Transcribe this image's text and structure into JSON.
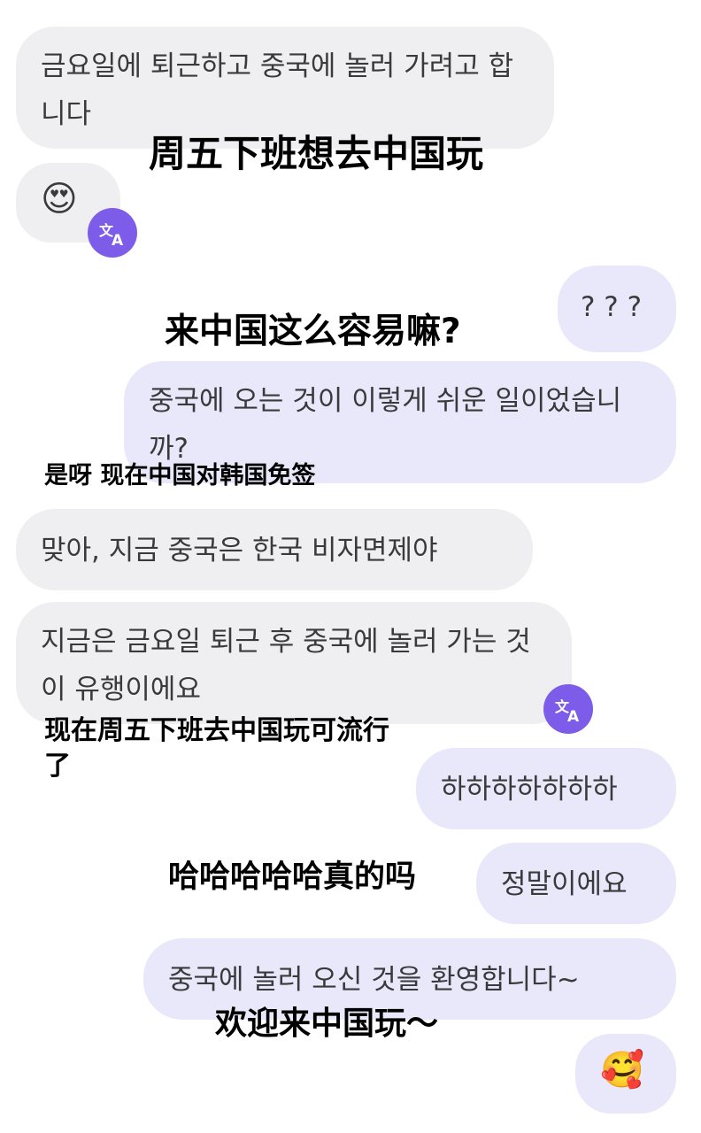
{
  "messages": [
    {
      "side": "received",
      "text": "금요일에 퇴근하고 중국에 놀러 가려고 합니다"
    },
    {
      "side": "received",
      "text": "😍"
    },
    {
      "side": "sent",
      "text": "? ? ?"
    },
    {
      "side": "sent",
      "text": "중국에 오는 것이 이렇게 쉬운 일이었습니까?"
    },
    {
      "side": "received",
      "text": "맞아, 지금 중국은 한국 비자면제야"
    },
    {
      "side": "received",
      "text": "지금은 금요일 퇴근 후 중국에 놀러 가는 것이 유행이에요"
    },
    {
      "side": "sent",
      "text": "하하하하하하하"
    },
    {
      "side": "sent",
      "text": "정말이에요"
    },
    {
      "side": "sent",
      "text": "중국에 놀러 오신 것을 환영합니다~"
    },
    {
      "side": "sent",
      "text": "🥰"
    }
  ],
  "captions": [
    "周五下班想去中国玩",
    "来中国这么容易嘛?",
    "是呀 现在中国对韩国免签",
    "现在周五下班去中国玩可流行了",
    "哈哈哈哈哈真的吗",
    "欢迎来中国玩～"
  ],
  "icons": {
    "translate": "translate-icon"
  },
  "colors": {
    "received_bubble": "#efeff1",
    "sent_bubble": "#e9e7fa",
    "translate_badge": "#7c5ce8"
  }
}
